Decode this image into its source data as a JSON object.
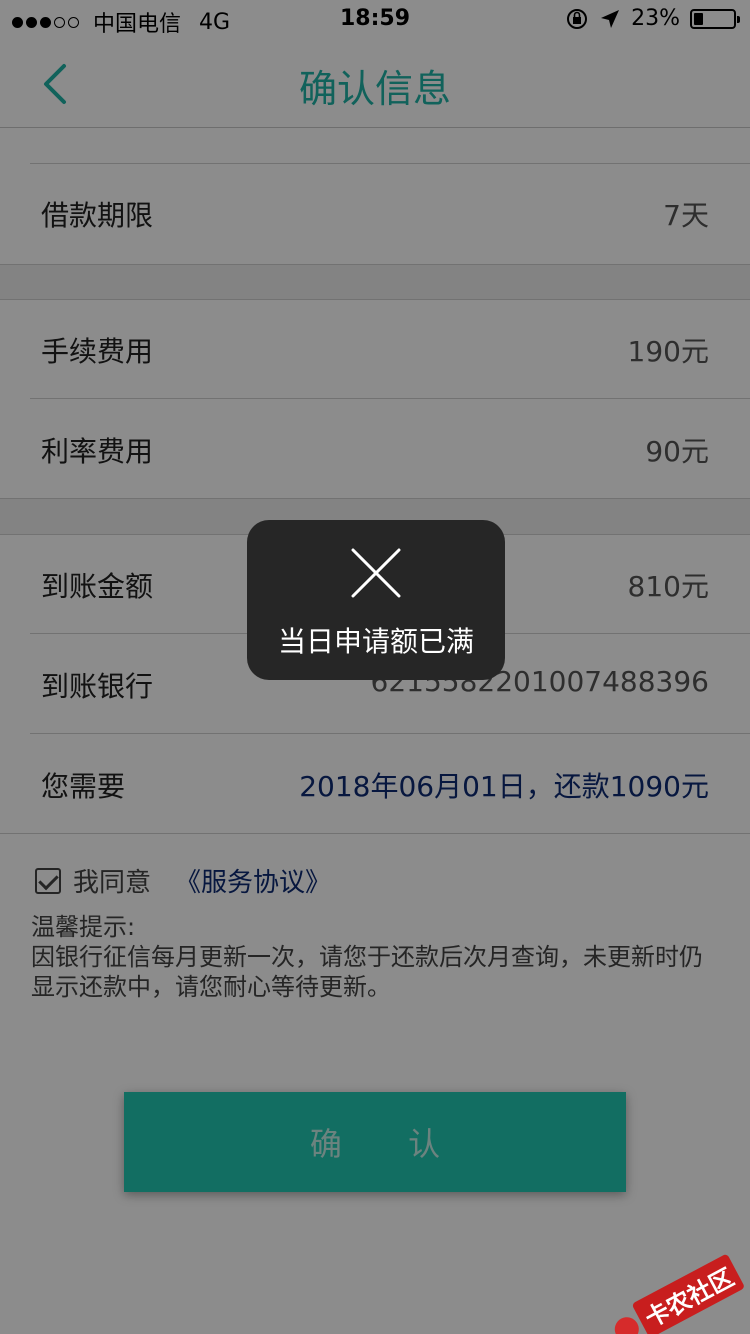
{
  "status_bar": {
    "carrier": "中国电信",
    "network": "4G",
    "time": "18:59",
    "battery": "23%",
    "battery_level": 0.23
  },
  "header": {
    "title": "确认信息"
  },
  "rows": [
    {
      "label": "借款期限",
      "value": "7天"
    },
    {
      "label": "手续费用",
      "value": "190元"
    },
    {
      "label": "利率费用",
      "value": "90元"
    },
    {
      "label": "到账金额",
      "value": "810元"
    },
    {
      "label": "到账银行",
      "value": "6215582201007488396"
    },
    {
      "label": "您需要",
      "value": "2018年06月01日，还款1090元"
    }
  ],
  "agreement": {
    "label": "我同意",
    "link": "《服务协议》",
    "checked": true
  },
  "tips": {
    "title": "温馨提示:",
    "body": "因银行征信每月更新一次，请您于还款后次月查询，未更新时仍显示还款中，请您耐心等待更新。"
  },
  "confirm_button": "确 认",
  "toast": {
    "message": "当日申请额已满"
  },
  "watermark": "卡农社区",
  "colors": {
    "accent": "#1fb3a6",
    "button": "#22c9b3",
    "link": "#0d2a73",
    "toast_bg": "#262626"
  }
}
